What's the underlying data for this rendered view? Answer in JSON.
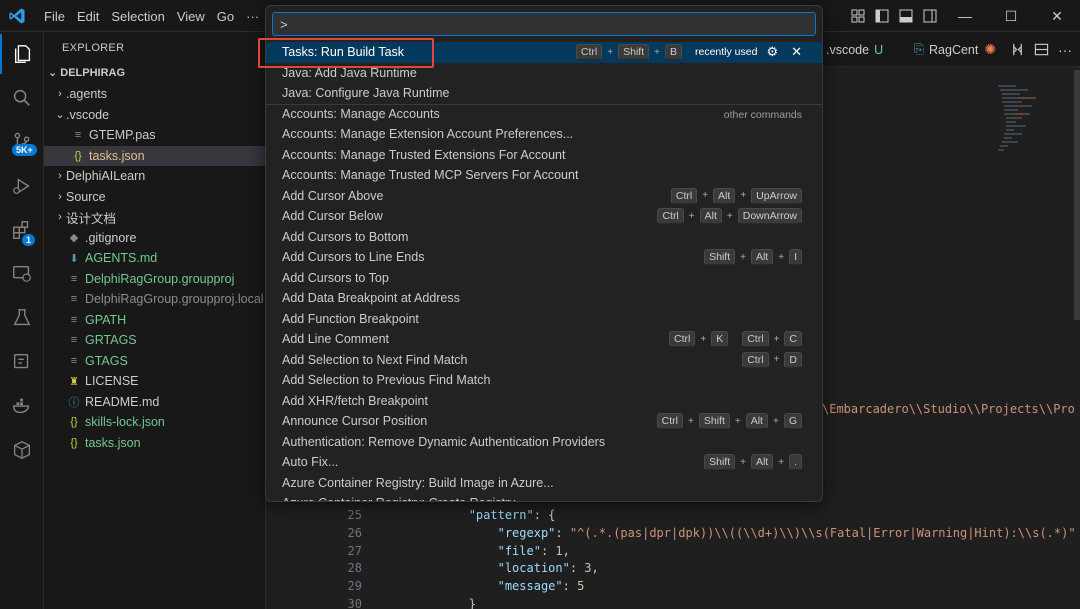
{
  "menu": {
    "items": [
      "File",
      "Edit",
      "Selection",
      "View",
      "Go",
      "···"
    ]
  },
  "window_controls": {
    "minimize": "—",
    "maximize": "☐",
    "close": "✕"
  },
  "activity_bar": {
    "source_control_badge": "5K+",
    "extensions_badge": "1"
  },
  "explorer": {
    "title": "EXPLORER",
    "folder": "DELPHIRAG",
    "items": [
      {
        "label": ".agents",
        "indent": 0,
        "chevron": ">",
        "icon": "",
        "color": "#cccccc"
      },
      {
        "label": ".vscode",
        "indent": 0,
        "chevron": "v",
        "icon": "",
        "color": "#cccccc"
      },
      {
        "label": "GTEMP.pas",
        "indent": 1,
        "chevron": "",
        "icon": "≡",
        "color": "#cccccc"
      },
      {
        "label": "tasks.json",
        "indent": 1,
        "chevron": "",
        "icon": "{}",
        "color": "#e2c08d"
      },
      {
        "label": "DelphiAILearn",
        "indent": 0,
        "chevron": ">",
        "icon": "",
        "color": "#cccccc"
      },
      {
        "label": "Source",
        "indent": 0,
        "chevron": ">",
        "icon": "",
        "color": "#cccccc"
      },
      {
        "label": "设计文档",
        "indent": 0,
        "chevron": ">",
        "icon": "",
        "color": "#cccccc"
      },
      {
        "label": ".gitignore",
        "indent": 0,
        "chevron": "",
        "icon": "◆",
        "color": "#cccccc"
      },
      {
        "label": "AGENTS.md",
        "indent": 0,
        "chevron": "",
        "icon": "⬇",
        "color": "#73c991"
      },
      {
        "label": "DelphiRagGroup.groupproj",
        "indent": 0,
        "chevron": "",
        "icon": "≡",
        "color": "#73c991"
      },
      {
        "label": "DelphiRagGroup.groupproj.local",
        "indent": 0,
        "chevron": "",
        "icon": "≡",
        "color": "#8c8c8c"
      },
      {
        "label": "GPATH",
        "indent": 0,
        "chevron": "",
        "icon": "≡",
        "color": "#73c991"
      },
      {
        "label": "GRTAGS",
        "indent": 0,
        "chevron": "",
        "icon": "≡",
        "color": "#73c991"
      },
      {
        "label": "GTAGS",
        "indent": 0,
        "chevron": "",
        "icon": "≡",
        "color": "#73c991"
      },
      {
        "label": "LICENSE",
        "indent": 0,
        "chevron": "",
        "icon": "♜",
        "color": "#cccccc"
      },
      {
        "label": "README.md",
        "indent": 0,
        "chevron": "",
        "icon": "ⓘ",
        "color": "#cccccc"
      },
      {
        "label": "skills-lock.json",
        "indent": 0,
        "chevron": "",
        "icon": "{}",
        "color": "#73c991"
      },
      {
        "label": "tasks.json",
        "indent": 0,
        "chevron": "",
        "icon": "{}",
        "color": "#73c991"
      }
    ]
  },
  "tabs": {
    "vscode_tab": ".vscode",
    "vscode_status": "U",
    "rag_tab": "RagCent"
  },
  "command_palette": {
    "input_value": ">",
    "commands": [
      {
        "label": "Tasks: Run Build Task",
        "keys": [
          [
            "Ctrl",
            "Shift",
            "B"
          ]
        ],
        "meta": "recently used"
      },
      {
        "label": "Java: Add Java Runtime",
        "keys": [],
        "meta": ""
      },
      {
        "label": "Java: Configure Java Runtime",
        "keys": [],
        "meta": ""
      },
      {
        "label": "Accounts: Manage Accounts",
        "keys": [],
        "meta": "other commands"
      },
      {
        "label": "Accounts: Manage Extension Account Preferences...",
        "keys": [],
        "meta": ""
      },
      {
        "label": "Accounts: Manage Trusted Extensions For Account",
        "keys": [],
        "meta": ""
      },
      {
        "label": "Accounts: Manage Trusted MCP Servers For Account",
        "keys": [],
        "meta": ""
      },
      {
        "label": "Add Cursor Above",
        "keys": [
          [
            "Ctrl",
            "Alt",
            "UpArrow"
          ]
        ],
        "meta": ""
      },
      {
        "label": "Add Cursor Below",
        "keys": [
          [
            "Ctrl",
            "Alt",
            "DownArrow"
          ]
        ],
        "meta": ""
      },
      {
        "label": "Add Cursors to Bottom",
        "keys": [],
        "meta": ""
      },
      {
        "label": "Add Cursors to Line Ends",
        "keys": [
          [
            "Shift",
            "Alt",
            "I"
          ]
        ],
        "meta": ""
      },
      {
        "label": "Add Cursors to Top",
        "keys": [],
        "meta": ""
      },
      {
        "label": "Add Data Breakpoint at Address",
        "keys": [],
        "meta": ""
      },
      {
        "label": "Add Function Breakpoint",
        "keys": [],
        "meta": ""
      },
      {
        "label": "Add Line Comment",
        "keys": [
          [
            "Ctrl",
            "K"
          ],
          [
            "Ctrl",
            "C"
          ]
        ],
        "meta": ""
      },
      {
        "label": "Add Selection to Next Find Match",
        "keys": [
          [
            "Ctrl",
            "D"
          ]
        ],
        "meta": ""
      },
      {
        "label": "Add Selection to Previous Find Match",
        "keys": [],
        "meta": ""
      },
      {
        "label": "Add XHR/fetch Breakpoint",
        "keys": [],
        "meta": ""
      },
      {
        "label": "Announce Cursor Position",
        "keys": [
          [
            "Ctrl",
            "Shift",
            "Alt",
            "G"
          ]
        ],
        "meta": ""
      },
      {
        "label": "Authentication: Remove Dynamic Authentication Providers",
        "keys": [],
        "meta": ""
      },
      {
        "label": "Auto Fix...",
        "keys": [
          [
            "Shift",
            "Alt",
            "."
          ]
        ],
        "meta": ""
      },
      {
        "label": "Azure Container Registry: Build Image in Azure...",
        "keys": [],
        "meta": ""
      },
      {
        "label": "Azure Container Registry: Create Registry",
        "keys": [],
        "meta": ""
      }
    ]
  },
  "code": {
    "path_fragment": "\\Embarcadero\\\\Studio\\\\Projects\\\\Pro",
    "lines": [
      {
        "n": "25",
        "parts": [
          [
            "k",
            "\"pattern\""
          ],
          [
            "p",
            ": {"
          ]
        ],
        "indent": 6
      },
      {
        "n": "26",
        "parts": [
          [
            "k",
            "\"regexp\""
          ],
          [
            "p",
            ": "
          ],
          [
            "s",
            "\"^(.*.(pas|dpr|dpk))\\\\((\\\\d+)\\\\)\\\\s(Fatal|Error|Warning|Hint):\\\\s(.*)\""
          ]
        ],
        "indent": 8
      },
      {
        "n": "27",
        "parts": [
          [
            "k",
            "\"file\""
          ],
          [
            "p",
            ": "
          ],
          [
            "n",
            "1"
          ],
          [
            "p",
            ","
          ]
        ],
        "indent": 8
      },
      {
        "n": "28",
        "parts": [
          [
            "k",
            "\"location\""
          ],
          [
            "p",
            ": "
          ],
          [
            "n",
            "3"
          ],
          [
            "p",
            ","
          ]
        ],
        "indent": 8
      },
      {
        "n": "29",
        "parts": [
          [
            "k",
            "\"message\""
          ],
          [
            "p",
            ": "
          ],
          [
            "n",
            "5"
          ]
        ],
        "indent": 8
      },
      {
        "n": "30",
        "parts": [
          [
            "p",
            "}"
          ]
        ],
        "indent": 6
      }
    ]
  },
  "colors": {
    "accent": "#0078d4",
    "highlight": "#04395e",
    "annotation_box": "#e0463f",
    "git_added": "#73c991"
  }
}
